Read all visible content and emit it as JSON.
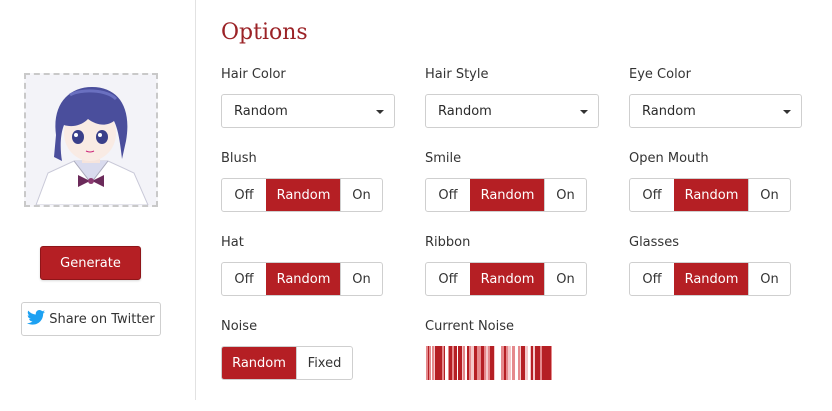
{
  "sidebar": {
    "generate_label": "Generate",
    "share_label": "Share on Twitter"
  },
  "options": {
    "title": "Options",
    "selects": [
      {
        "label": "Hair Color",
        "value": "Random"
      },
      {
        "label": "Hair Style",
        "value": "Random"
      },
      {
        "label": "Eye Color",
        "value": "Random"
      }
    ],
    "toggles": [
      {
        "label": "Blush",
        "choices": [
          "Off",
          "Random",
          "On"
        ],
        "selected": "Random"
      },
      {
        "label": "Smile",
        "choices": [
          "Off",
          "Random",
          "On"
        ],
        "selected": "Random"
      },
      {
        "label": "Open Mouth",
        "choices": [
          "Off",
          "Random",
          "On"
        ],
        "selected": "Random"
      },
      {
        "label": "Hat",
        "choices": [
          "Off",
          "Random",
          "On"
        ],
        "selected": "Random"
      },
      {
        "label": "Ribbon",
        "choices": [
          "Off",
          "Random",
          "On"
        ],
        "selected": "Random"
      },
      {
        "label": "Glasses",
        "choices": [
          "Off",
          "Random",
          "On"
        ],
        "selected": "Random"
      }
    ],
    "noise": {
      "label": "Noise",
      "choices": [
        "Random",
        "Fixed"
      ],
      "selected": "Random"
    },
    "current_noise_label": "Current Noise"
  },
  "colors": {
    "accent": "#b51f24",
    "title": "#9b2226",
    "twitter": "#1da1f2"
  }
}
